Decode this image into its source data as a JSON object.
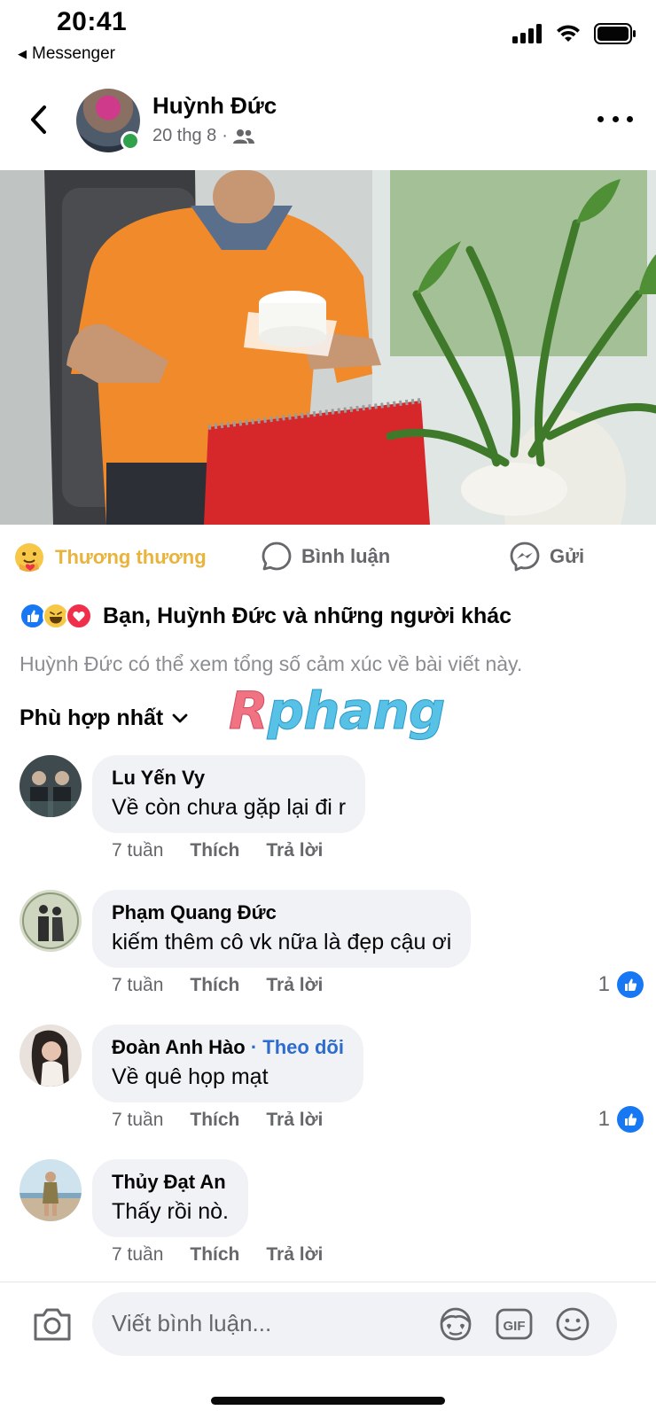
{
  "status_bar": {
    "time": "20:41",
    "back_app": "Messenger"
  },
  "header": {
    "author_name": "Huỳnh Đức",
    "date": "20 thg 8",
    "separator": "·",
    "audience_icon": "friends-icon",
    "online": true
  },
  "actions": {
    "care_label": "Thương thương",
    "comment_label": "Bình luận",
    "send_label": "Gửi"
  },
  "reactions": {
    "icons": [
      "like",
      "haha",
      "love"
    ],
    "summary": "Bạn, Huỳnh Đức và những người khác",
    "privacy_note": "Huỳnh Đức có thể xem tổng số cảm xúc về bài viết này."
  },
  "sort": {
    "label": "Phù hợp nhất"
  },
  "watermark": {
    "text_a": "R",
    "text_b": "phang"
  },
  "comments": [
    {
      "name": "Lu Yến Vy",
      "follow": "",
      "text": "Về còn chưa gặp lại đi r",
      "time": "7 tuần",
      "like_label": "Thích",
      "reply_label": "Trả lời",
      "likes": ""
    },
    {
      "name": "Phạm Quang Đức",
      "follow": "",
      "text": "kiếm thêm cô vk nữa là đẹp cậu ơi",
      "time": "7 tuần",
      "like_label": "Thích",
      "reply_label": "Trả lời",
      "likes": "1"
    },
    {
      "name": "Đoàn Anh Hào",
      "follow": " · Theo dõi",
      "text": "Về quê họp mạt",
      "time": "7 tuần",
      "like_label": "Thích",
      "reply_label": "Trả lời",
      "likes": "1"
    },
    {
      "name": "Thủy Đạt An",
      "follow": "",
      "text": "Thấy rồi nò.",
      "time": "7 tuần",
      "like_label": "Thích",
      "reply_label": "Trả lời",
      "likes": ""
    }
  ],
  "composer": {
    "placeholder": "Viết bình luận...",
    "gif_label": "GIF"
  },
  "colors": {
    "accent": "#1877f2",
    "care": "#e8b43b",
    "online": "#31a24c",
    "bubble": "#f0f2f5",
    "muted": "#65676b"
  }
}
